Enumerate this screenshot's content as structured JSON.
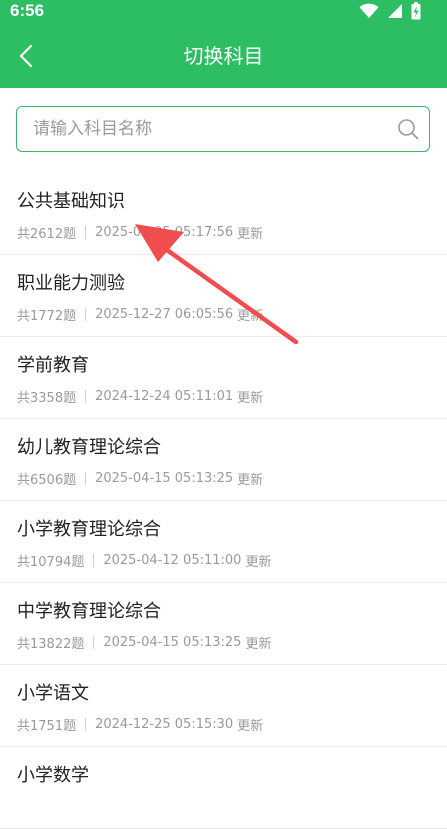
{
  "status_bar": {
    "time": "6:56"
  },
  "header": {
    "title": "切换科目"
  },
  "search": {
    "placeholder": "请输入科目名称"
  },
  "subjects": [
    {
      "name": "公共基础知识",
      "count": "共2612题",
      "updated_at": "2025-03-05 05:17:56",
      "updated_label": "更新"
    },
    {
      "name": "职业能力测验",
      "count": "共1772题",
      "updated_at": "2025-12-27 06:05:56",
      "updated_label": "更新"
    },
    {
      "name": "学前教育",
      "count": "共3358题",
      "updated_at": "2024-12-24 05:11:01",
      "updated_label": "更新"
    },
    {
      "name": "幼儿教育理论综合",
      "count": "共6506题",
      "updated_at": "2025-04-15 05:13:25",
      "updated_label": "更新"
    },
    {
      "name": "小学教育理论综合",
      "count": "共10794题",
      "updated_at": "2025-04-12 05:11:00",
      "updated_label": "更新"
    },
    {
      "name": "中学教育理论综合",
      "count": "共13822题",
      "updated_at": "2025-04-15 05:13:25",
      "updated_label": "更新"
    },
    {
      "name": "小学语文",
      "count": "共1751题",
      "updated_at": "2024-12-25 05:15:30",
      "updated_label": "更新"
    },
    {
      "name": "小学数学",
      "count": "",
      "updated_at": "",
      "updated_label": ""
    }
  ],
  "colors": {
    "brand_green": "#2dbd62",
    "annotation_arrow": "#f04e4e"
  }
}
